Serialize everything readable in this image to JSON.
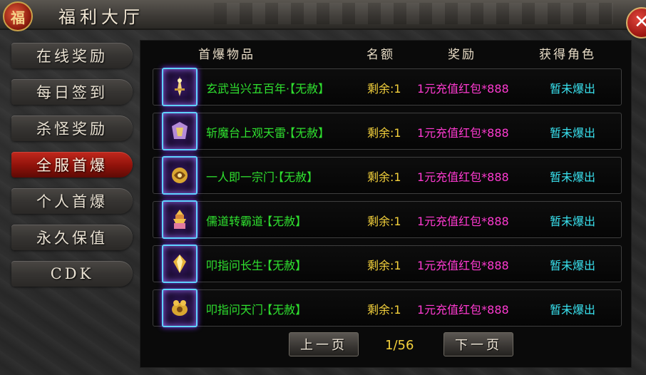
{
  "title": "福利大厅",
  "logo_glyph": "福",
  "close_glyph": "✕",
  "sidebar": {
    "items": [
      {
        "label": "在线奖励",
        "active": false
      },
      {
        "label": "每日签到",
        "active": false
      },
      {
        "label": "杀怪奖励",
        "active": false
      },
      {
        "label": "全服首爆",
        "active": true
      },
      {
        "label": "个人首爆",
        "active": false
      },
      {
        "label": "永久保值",
        "active": false
      },
      {
        "label": "CDK",
        "active": false
      }
    ]
  },
  "table": {
    "headers": {
      "item": "首爆物品",
      "quota": "名额",
      "reward": "奖励",
      "winner": "获得角色"
    },
    "rows": [
      {
        "name": "玄武当兴五百年·【无赦】",
        "quota": "剩余:1",
        "reward": "1元充值红包*888",
        "winner": "暂未爆出",
        "icon": "sword-icon"
      },
      {
        "name": "斩魔台上观天雷·【无赦】",
        "quota": "剩余:1",
        "reward": "1元充值红包*888",
        "winner": "暂未爆出",
        "icon": "armor-icon"
      },
      {
        "name": "一人即一宗门·【无赦】",
        "quota": "剩余:1",
        "reward": "1元充值红包*888",
        "winner": "暂未爆出",
        "icon": "dragon-icon"
      },
      {
        "name": "儒道转霸道·【无赦】",
        "quota": "剩余:1",
        "reward": "1元充值红包*888",
        "winner": "暂未爆出",
        "icon": "pagoda-icon"
      },
      {
        "name": "叩指问长生·【无赦】",
        "quota": "剩余:1",
        "reward": "1元充值红包*888",
        "winner": "暂未爆出",
        "icon": "gem-icon"
      },
      {
        "name": "叩指问天门·【无赦】",
        "quota": "剩余:1",
        "reward": "1元充值红包*888",
        "winner": "暂未爆出",
        "icon": "beast-icon"
      }
    ]
  },
  "pagination": {
    "prev": "上一页",
    "next": "下一页",
    "page": "1/56"
  },
  "colors": {
    "item_name": "#2fe02f",
    "quota": "#f5d23c",
    "reward": "#ff3ad1",
    "winner": "#39e1ee",
    "active_tab": "#b31f15"
  }
}
